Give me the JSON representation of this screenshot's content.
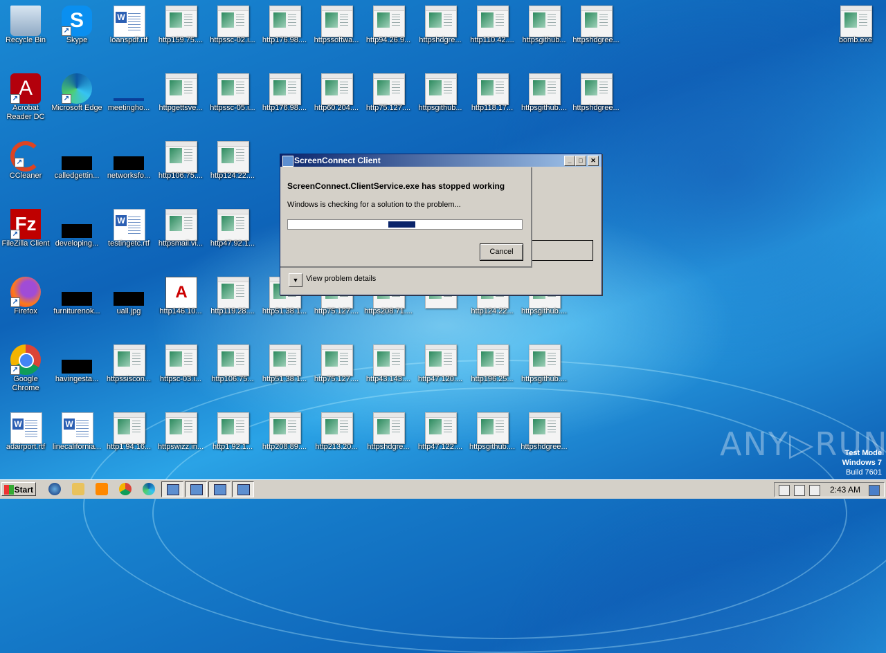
{
  "desktop": {
    "col1": [
      "Recycle Bin",
      "Acrobat Reader DC",
      "CCleaner",
      "FileZilla Client",
      "Firefox",
      "Google Chrome",
      "adairport.rtf"
    ],
    "col2": [
      "Skype",
      "Microsoft Edge",
      "calledgettin...",
      "developing...",
      "furniturenok...",
      "havingesta...",
      "linecalifornia..."
    ],
    "col3": [
      "loanspdf.rtf",
      "meetingho...",
      "networksfo...",
      "testingetc.rtf",
      "uall.jpg",
      "httpssiscon...",
      "http1.94.16..."
    ],
    "row1": [
      "http159.75....",
      "httpssc-02.i...",
      "http176.98....",
      "httpssoftwa...",
      "http94.26.9...",
      "httpshdgre...",
      "http110.42....",
      "httpsgithub...",
      "httpshdgree..."
    ],
    "row2": [
      "httpgettsve...",
      "httpssc-05.i...",
      "http176.98....",
      "http60.204....",
      "http75.127....",
      "httpsgithub...",
      "http118.17...",
      "httpsgithub....",
      "httpshdgree..."
    ],
    "row3": [
      "http106.75....",
      "http124.22...."
    ],
    "row4": [
      "httpsmail.vi...",
      "http47.92.1..."
    ],
    "row5": [
      "http146.10...",
      "http119.28....",
      "http51.38.1...",
      "http75.127....",
      "https208.71....",
      "",
      "http124.22...",
      "httpsgithub...."
    ],
    "row6": [
      "httpsc-03.i...",
      "http106.75...",
      "http51.38.1...",
      "http75.127....",
      "http43.143....",
      "http47.120....",
      "http196.25...",
      "httpsgithub...."
    ],
    "row7": [
      "httpswizz.in...",
      "http1.92.1...",
      "http208.89....",
      "http213.20...",
      "httpshdgre...",
      "http47.122....",
      "httpsgithub....",
      "httpshdgree..."
    ],
    "bomb": "bomb.exe"
  },
  "dialog": {
    "title": "ScreenConnect Client",
    "heading": "ScreenConnect.ClientService.exe has stopped working",
    "message": "Windows is checking for a solution to the problem...",
    "progress_segment": {
      "start": 0.43,
      "width": 0.115
    },
    "cancel": "Cancel",
    "details": "View problem details",
    "btn_min": "_",
    "btn_max": "□",
    "btn_close": "✕"
  },
  "taskbar": {
    "start": "Start",
    "clock": "2:43 AM"
  },
  "watermark": "ANY▷RUN",
  "testmode": {
    "line1": "Test Mode",
    "line2": "Windows 7",
    "line3": "Build 7601"
  }
}
